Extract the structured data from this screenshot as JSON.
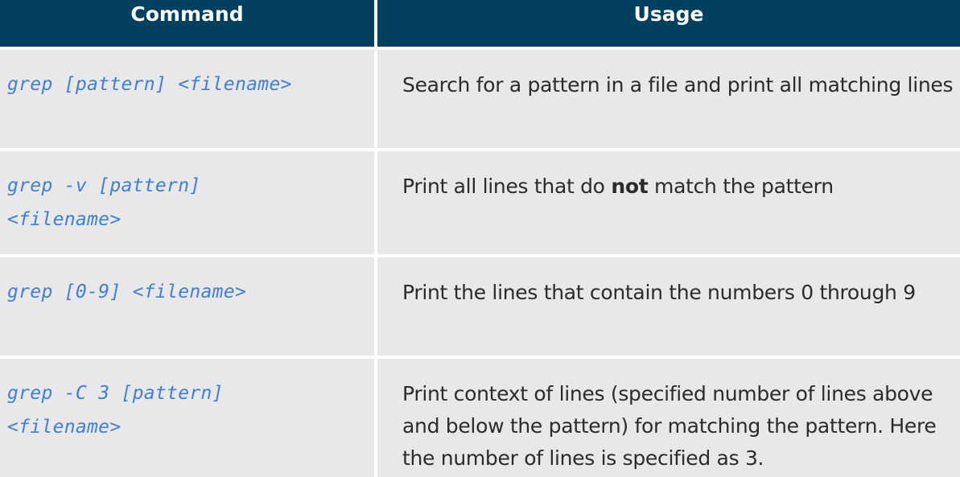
{
  "headers": {
    "command": "Command",
    "usage": "Usage"
  },
  "rows": [
    {
      "command_line1": "grep [pattern] <filename>",
      "command_line2": "",
      "usage_before": "Search for a pattern in a file and print all matching lines",
      "usage_bold": "",
      "usage_after": ""
    },
    {
      "command_line1": "grep -v [pattern]",
      "command_line2": "<filename>",
      "usage_before": "Print all lines that do ",
      "usage_bold": "not",
      "usage_after": " match the pattern"
    },
    {
      "command_line1": "grep [0-9] <filename>",
      "command_line2": "",
      "usage_before": "Print the lines that contain the numbers 0 through 9",
      "usage_bold": "",
      "usage_after": ""
    },
    {
      "command_line1": "grep -C 3 [pattern]",
      "command_line2": "<filename>",
      "usage_before": "Print context of lines (specified number of lines above and below the pattern) for matching the pattern. Here the number of lines is specified as 3.",
      "usage_bold": "",
      "usage_after": ""
    }
  ],
  "colors": {
    "header_bg": "#01405f",
    "header_text": "#ffffff",
    "row_bg": "#e8e8e8",
    "command_text": "#3d7fd9",
    "usage_text": "#2b2b2b"
  }
}
